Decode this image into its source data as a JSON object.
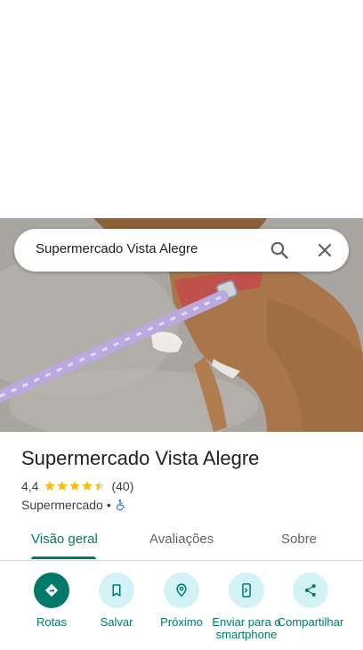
{
  "search": {
    "query": "Supermercado Vista Alegre"
  },
  "place": {
    "name": "Supermercado Vista Alegre",
    "rating": "4,4",
    "rating_value": 4.4,
    "rating_max": 5,
    "review_count": "(40)",
    "category": "Supermercado",
    "separator": "•"
  },
  "tabs": [
    {
      "label": "Visão geral",
      "active": true
    },
    {
      "label": "Avaliações",
      "active": false
    },
    {
      "label": "Sobre",
      "active": false
    }
  ],
  "actions": [
    {
      "label": "Rotas",
      "icon": "directions-icon"
    },
    {
      "label": "Salvar",
      "icon": "bookmark-icon"
    },
    {
      "label": "Próximo",
      "icon": "nearby-icon"
    },
    {
      "label": "Enviar para o smartphone",
      "icon": "send-to-phone-icon"
    },
    {
      "label": "Compartilhar",
      "icon": "share-icon"
    }
  ],
  "colors": {
    "accent": "#00796b",
    "star": "#fbbc04",
    "action_bg": "#d2f2f5",
    "accessibility": "#1a73e8"
  }
}
